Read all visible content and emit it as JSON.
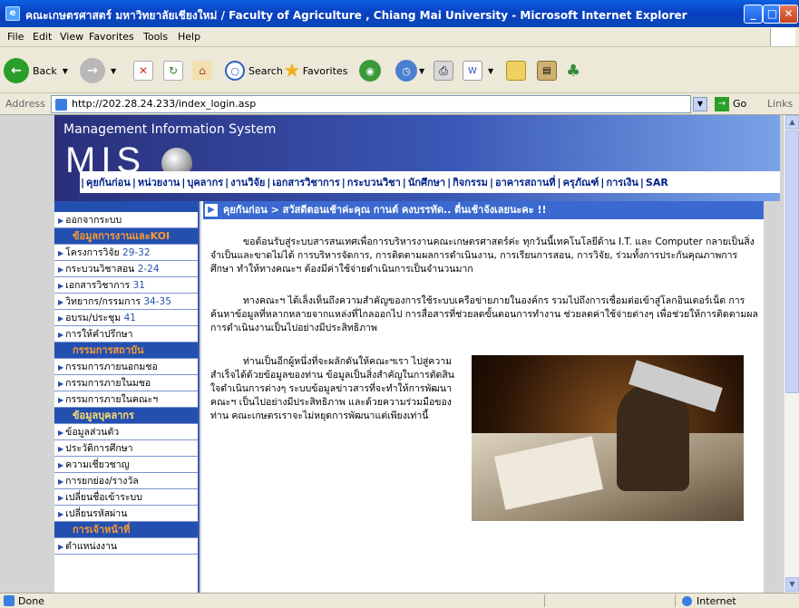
{
  "window": {
    "title": "คณะเกษตรศาสตร์ มหาวิทยาลัยเชียงใหม่ / Faculty of Agriculture , Chiang Mai University  - Microsoft Internet Explorer"
  },
  "menu": [
    "File",
    "Edit",
    "View",
    "Favorites",
    "Tools",
    "Help"
  ],
  "toolbar": {
    "back": "Back",
    "search": "Search",
    "favorites": "Favorites"
  },
  "address": {
    "label": "Address",
    "url": "http://202.28.24.233/index_login.asp",
    "go": "Go",
    "links": "Links"
  },
  "header": {
    "system": "Management Information System",
    "logo": "MIS",
    "nav": [
      "คุยกันก่อน",
      "หน่วยงาน",
      "บุคลากร",
      "งานวิจัย",
      "เอกสารวิชาการ",
      "กระบวนวิชา",
      "นักศึกษา",
      "กิจกรรม",
      "อาคารสถานที่",
      "ครุภัณฑ์",
      "การเงิน",
      "SAR"
    ]
  },
  "sidebar": {
    "logout": "ออกจากระบบ",
    "sec1": "ข้อมูลการงานและKOI",
    "items1": [
      {
        "label": "โครงการวิจัย",
        "num": "29-32"
      },
      {
        "label": "กระบวนวิชาสอน",
        "num": "2-24"
      },
      {
        "label": "เอกสารวิชาการ",
        "num": "31"
      },
      {
        "label": "วิทยากร/กรรมการ",
        "num": "34-35"
      },
      {
        "label": "อบรม/ประชุม",
        "num": "41"
      },
      {
        "label": "การให้คำปรึกษา",
        "num": ""
      }
    ],
    "sec2": "กรรมการสถาบัน",
    "items2": [
      "กรรมการภายนอกมชอ",
      "กรรมการภายในมชอ",
      "กรรมการภายในคณะฯ"
    ],
    "sec3": "ข้อมูลบุคลากร",
    "items3": [
      "ข้อมูลส่วนตัว",
      "ประวัติการศึกษา",
      "ความเชี่ยวชาญ",
      "การยกย่อง/รางวัล",
      "เปลี่ยนชื่อเข้าระบบ",
      "เปลี่ยนรหัสผ่าน"
    ],
    "sec4": "การเจ้าหน้าที่",
    "items4": [
      "ตำแหน่งงาน"
    ]
  },
  "main": {
    "breadcrumb": "คุยกันก่อน > สวัสดีตอนเช้าค่ะคุณ กานต์ คงบรรทัด.. ตื่นเช้าจังเลยนะคะ !!",
    "p1": "ขอต้อนรับสู่ระบบสารสนเทศเพื่อการบริหารงานคณะเกษตรศาสตร์ค่ะ ทุกวันนี้เทคโนโลยีด้าน I.T. และ Computer กลายเป็นสิ่งจำเป็นและขาดไม่ได้ การบริหารจัดการ, การติดตามผลการดำเนินงาน, การเรียนการสอน, การวิจัย, ร่วมทั้งการประกันคุณภาพการศึกษา ทำให้ทางคณะฯ ต้องมีค่าใช้จ่ายดำเนินการเป็นจำนวนมาก",
    "p2": "ทางคณะฯ ได้เล็งเห็นถึงความสำคัญของการใช้ระบบเครือข่ายภายในองค์กร รวมไปถึงการเชื่อมต่อเข้าสู่โลกอินเตอร์เน็ต การค้นหาข้อมูลที่หลากหลายจากแหล่งที่ไกลออกไป การสื่อสารที่ช่วยลดขั้นตอนการทำงาน ช่วยลดค่าใช้จ่ายต่างๆ เพื่อช่วยให้การติดตามผลการดำเนินงานเป็นไปอย่างมีประสิทธิภาพ",
    "p3": "ท่านเป็นอีกผู้หนึ่งที่จะผลักดันให้คณะฯเรา ไปสู่ความสำเร็จได้ด้วยข้อมูลของท่าน ข้อมูลเป็นสิ่งสำคัญในการตัดสินใจดำเนินการต่างๆ ระบบข้อมูลข่าวสารที่จะทำให้การพัฒนาคณะฯ เป็นไปอย่างมีประสิทธิภาพ และด้วยความร่วมมือของท่าน คณะเกษตรเราจะไม่หยุดการพัฒนาแต่เพียงเท่านี้"
  },
  "status": {
    "left": "Done",
    "right": "Internet"
  }
}
